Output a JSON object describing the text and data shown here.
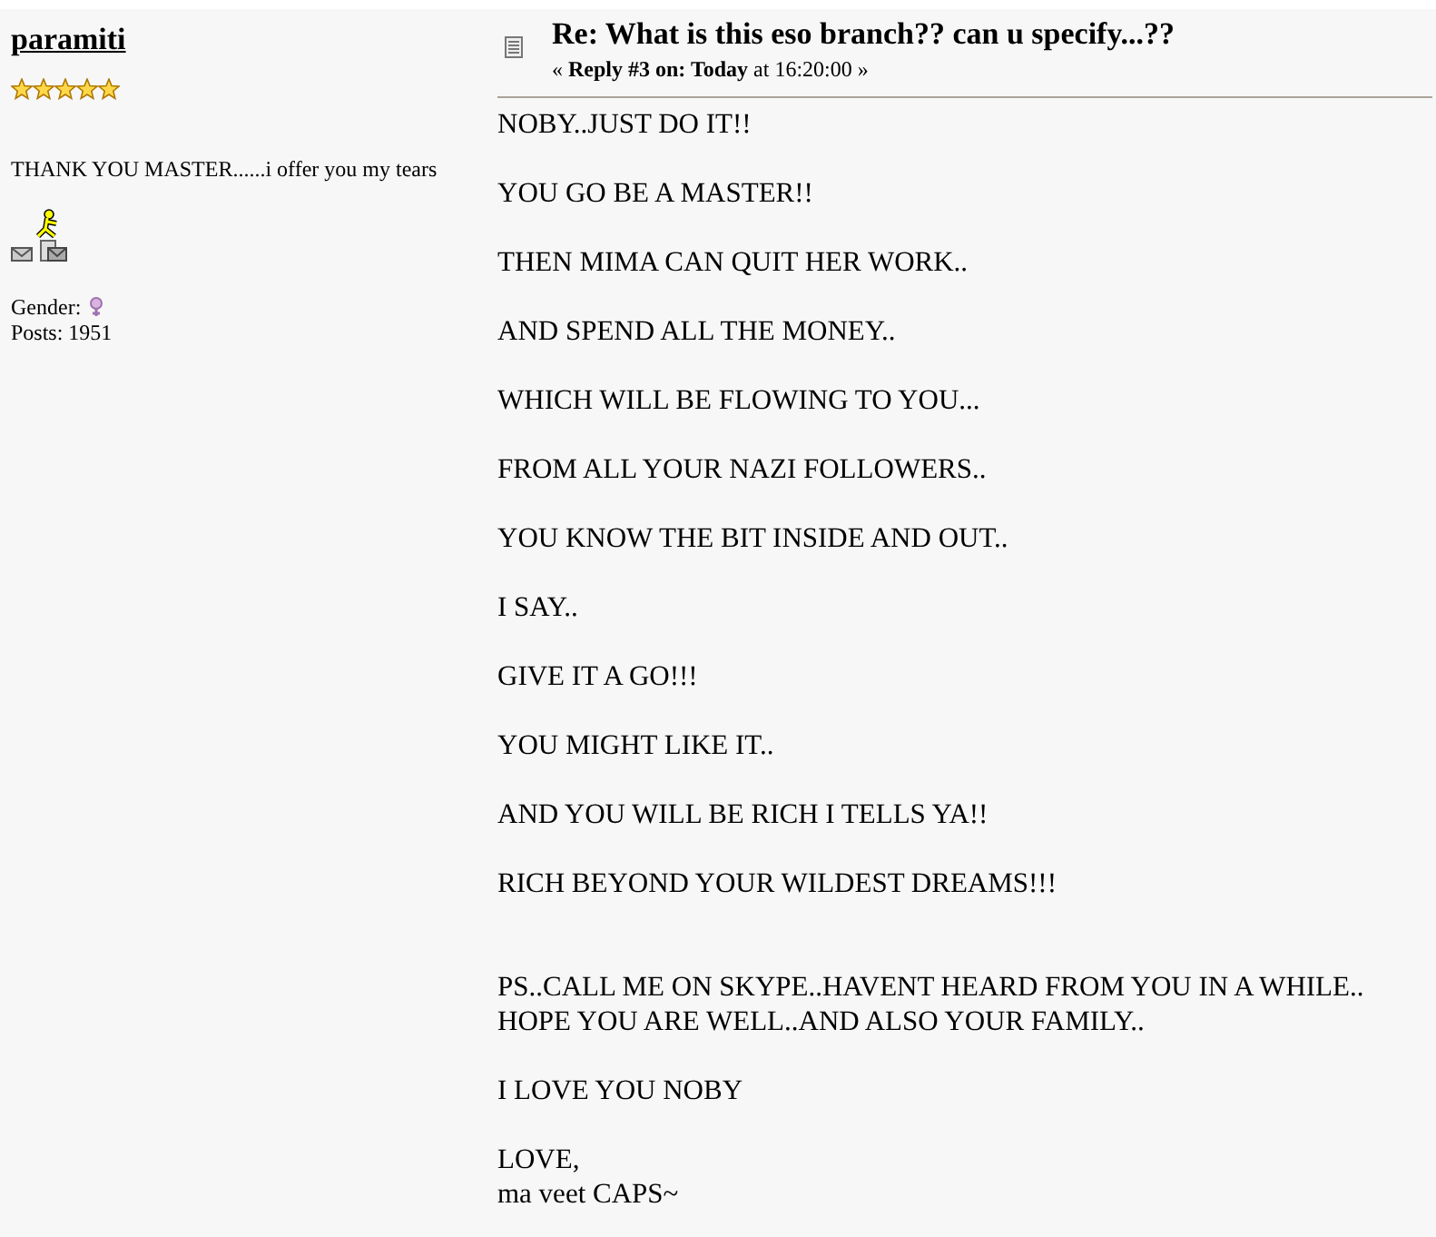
{
  "poster": {
    "name": "paramiti",
    "stars": 5,
    "personal_text": "THANK YOU MASTER......i offer you my tears",
    "gender_label": "Gender:",
    "posts": "Posts: 1951"
  },
  "post": {
    "subject": "Re: What is this eso branch?? can u specify...??",
    "reply_info": "« **Reply #3 on: Today** at 16:20:00 »",
    "paragraphs": [
      {
        "lines": [
          "NOBY..JUST DO IT!!"
        ]
      },
      {
        "lines": [
          "YOU GO BE A MASTER!!"
        ]
      },
      {
        "lines": [
          "THEN MIMA CAN QUIT HER WORK.."
        ]
      },
      {
        "lines": [
          "AND SPEND ALL THE MONEY.."
        ]
      },
      {
        "lines": [
          "WHICH WILL BE FLOWING TO YOU..."
        ]
      },
      {
        "lines": [
          "FROM ALL YOUR NAZI FOLLOWERS.."
        ]
      },
      {
        "lines": [
          "YOU KNOW THE BIT INSIDE AND OUT.."
        ]
      },
      {
        "lines": [
          "I SAY.."
        ]
      },
      {
        "lines": [
          "GIVE IT A GO!!!"
        ]
      },
      {
        "lines": [
          "YOU MIGHT LIKE IT.."
        ]
      },
      {
        "lines": [
          "AND YOU WILL BE RICH I TELLS YA!!"
        ]
      },
      {
        "lines": [
          "RICH BEYOND YOUR WILDEST DREAMS!!!"
        ]
      },
      {
        "gap_before": true,
        "lines": [
          "PS..CALL ME ON SKYPE..HAVENT HEARD FROM YOU IN A WHILE..",
          "HOPE YOU ARE WELL..AND ALSO YOUR FAMILY.."
        ]
      },
      {
        "lines": [
          "I LOVE YOU NOBY"
        ]
      },
      {
        "lines": [
          "LOVE,",
          "ma veet CAPS~"
        ]
      }
    ]
  }
}
